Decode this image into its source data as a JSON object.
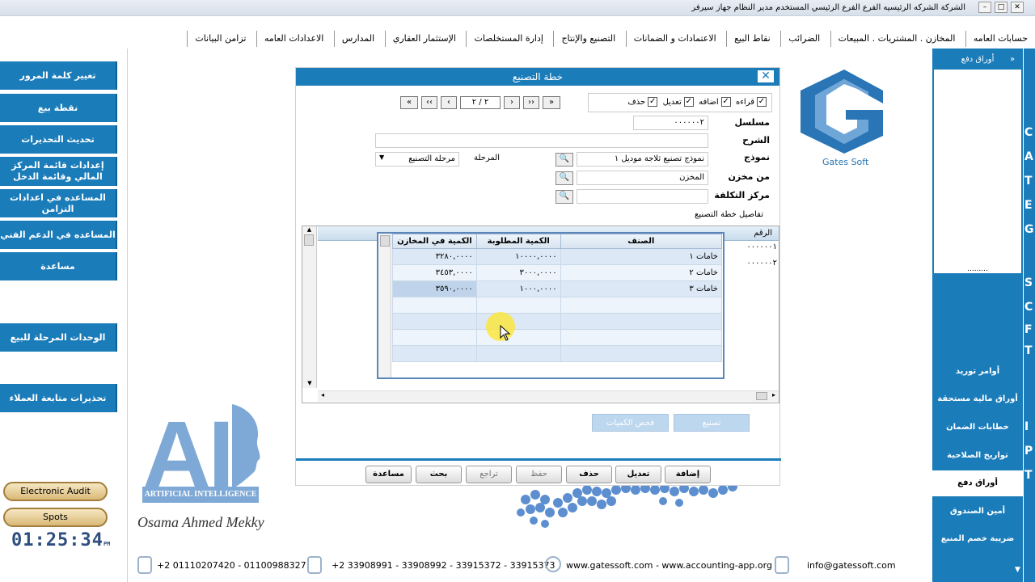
{
  "window": {
    "title": "الشركة الشركه الرئيسيه   الفرع الفرع الرئيسي   المستخدم مدير النظام   جهاز سيرفر"
  },
  "menu": [
    "حسابات العامه",
    "المخازن . المشتريات . المبيعات",
    "الضرائب",
    "نقاط البيع",
    "الاعتمادات و الضمانات",
    "التصنيع والإنتاج",
    "إدارة المستخلصات",
    "الإستثمار العقاري",
    "المدارس",
    "الاعدادات العامه",
    "تزامن البيانات"
  ],
  "left_buttons": [
    "تغيير كلمة المرور",
    "نقطة بيع",
    "تحديث التحذيرات",
    "إعدادات قائمة المركز المالي وقائمة الدخل",
    "المساعده في اعدادات التزامن",
    "المساعده في الدعم الفني",
    "مساعدة",
    "الوحدات المرحلة للبيع",
    "تحذيرات متابعة العملاء"
  ],
  "gold_buttons": [
    "Electronic Audit",
    "Spots"
  ],
  "clock": {
    "time": "01:25:34",
    "ampm": "PM"
  },
  "right_panel": {
    "header": "أوراق دفع",
    "dots": ".........",
    "items": [
      "أوامر توريد",
      "أوراق مالية مستحقة",
      "خطابات الضمان",
      "تواريخ الصلاحية",
      "أوراق دفع",
      "أمين الصندوق",
      "ضريبة خصم المنبع"
    ],
    "active_index": 4
  },
  "far_right_letters": [
    "C",
    "A",
    "T",
    "E",
    "G",
    "S",
    "C",
    "F",
    "T",
    "I",
    "P",
    "T"
  ],
  "dialog": {
    "title": "خطة التصنيع",
    "close": "✕",
    "nav": {
      "first": "«",
      "prev_page": "‹‹",
      "prev": "‹",
      "position": "٢ / ٢",
      "next": "›",
      "next_page": "››",
      "last": "»"
    },
    "permissions": [
      {
        "label": "قراءه",
        "checked": true
      },
      {
        "label": "اضافه",
        "checked": true
      },
      {
        "label": "تعديل",
        "checked": true
      },
      {
        "label": "حذف",
        "checked": true
      }
    ],
    "labels": {
      "serial": "مسلسل",
      "description": "الشرح",
      "model": "نموذج",
      "stage": "المرحلة",
      "from_store": "من مخزن",
      "cost_center": "مركز التكلفة",
      "details_title": "تفاصيل خطة التصنيع"
    },
    "values": {
      "serial": "٠٠٠٠٠٠٢",
      "description": "",
      "model": "نموذج تصنيع ثلاجة موديل ١",
      "stage": "مرحلة التصنيع",
      "from_store": "المخزن",
      "cost_center": ""
    },
    "grid": {
      "header_visible": "الرقم",
      "rows": [
        "٠٠٠٠٠٠١",
        "٠٠٠٠٠٠٢"
      ]
    },
    "popup": {
      "columns": [
        "الصنف",
        "الكمية المطلوبة",
        "الكمية في المخازن"
      ],
      "rows": [
        [
          "خامات ١",
          "١٠٠٠٠,٠٠٠٠",
          "٣٢٨٠,٠٠٠٠"
        ],
        [
          "خامات ٢",
          "٣٠٠٠,٠٠٠٠",
          "٣٤٥٣,٠٠٠٠"
        ],
        [
          "خامات ٣",
          "١٠٠٠,٠٠٠٠",
          "٣٥٩٠,٠٠٠٠"
        ]
      ]
    },
    "action_buttons": {
      "manufacture": "تصنيع",
      "check_quantities": "فحص الكميات"
    },
    "toolbar": {
      "add": "إضافة",
      "edit": "تعديل",
      "delete": "حذف",
      "save": "حفظ",
      "undo": "تراجع",
      "search": "بحث",
      "help": "مساعدة"
    }
  },
  "brand": {
    "name": "Gates Soft",
    "ai_letters": "AI",
    "ai_band": "ARTIFICIAL INTELLIGENCE",
    "signature": "Osama Ahmed Mekky"
  },
  "footer": {
    "mobile": "+2 01110207420 - 01100988327",
    "phone": "+2 33908991 - 33908992 - 33915372 - 33915373",
    "web": "www.gatessoft.com   -   www.accounting-app.org",
    "email": "info@gatessoft.com"
  },
  "colors": {
    "accent": "#1b7cba",
    "popup_border": "#5b86b9"
  }
}
